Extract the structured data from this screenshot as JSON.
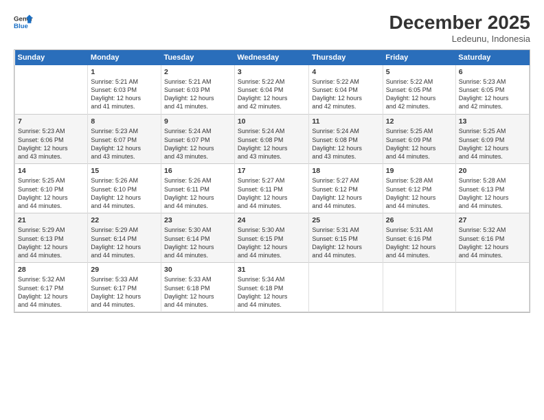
{
  "logo": {
    "line1": "General",
    "line2": "Blue"
  },
  "title": "December 2025",
  "location": "Ledeunu, Indonesia",
  "days_of_week": [
    "Sunday",
    "Monday",
    "Tuesday",
    "Wednesday",
    "Thursday",
    "Friday",
    "Saturday"
  ],
  "weeks": [
    [
      {
        "day": "",
        "info": ""
      },
      {
        "day": "1",
        "info": "Sunrise: 5:21 AM\nSunset: 6:03 PM\nDaylight: 12 hours\nand 41 minutes."
      },
      {
        "day": "2",
        "info": "Sunrise: 5:21 AM\nSunset: 6:03 PM\nDaylight: 12 hours\nand 41 minutes."
      },
      {
        "day": "3",
        "info": "Sunrise: 5:22 AM\nSunset: 6:04 PM\nDaylight: 12 hours\nand 42 minutes."
      },
      {
        "day": "4",
        "info": "Sunrise: 5:22 AM\nSunset: 6:04 PM\nDaylight: 12 hours\nand 42 minutes."
      },
      {
        "day": "5",
        "info": "Sunrise: 5:22 AM\nSunset: 6:05 PM\nDaylight: 12 hours\nand 42 minutes."
      },
      {
        "day": "6",
        "info": "Sunrise: 5:23 AM\nSunset: 6:05 PM\nDaylight: 12 hours\nand 42 minutes."
      }
    ],
    [
      {
        "day": "7",
        "info": "Sunrise: 5:23 AM\nSunset: 6:06 PM\nDaylight: 12 hours\nand 43 minutes."
      },
      {
        "day": "8",
        "info": "Sunrise: 5:23 AM\nSunset: 6:07 PM\nDaylight: 12 hours\nand 43 minutes."
      },
      {
        "day": "9",
        "info": "Sunrise: 5:24 AM\nSunset: 6:07 PM\nDaylight: 12 hours\nand 43 minutes."
      },
      {
        "day": "10",
        "info": "Sunrise: 5:24 AM\nSunset: 6:08 PM\nDaylight: 12 hours\nand 43 minutes."
      },
      {
        "day": "11",
        "info": "Sunrise: 5:24 AM\nSunset: 6:08 PM\nDaylight: 12 hours\nand 43 minutes."
      },
      {
        "day": "12",
        "info": "Sunrise: 5:25 AM\nSunset: 6:09 PM\nDaylight: 12 hours\nand 44 minutes."
      },
      {
        "day": "13",
        "info": "Sunrise: 5:25 AM\nSunset: 6:09 PM\nDaylight: 12 hours\nand 44 minutes."
      }
    ],
    [
      {
        "day": "14",
        "info": "Sunrise: 5:25 AM\nSunset: 6:10 PM\nDaylight: 12 hours\nand 44 minutes."
      },
      {
        "day": "15",
        "info": "Sunrise: 5:26 AM\nSunset: 6:10 PM\nDaylight: 12 hours\nand 44 minutes."
      },
      {
        "day": "16",
        "info": "Sunrise: 5:26 AM\nSunset: 6:11 PM\nDaylight: 12 hours\nand 44 minutes."
      },
      {
        "day": "17",
        "info": "Sunrise: 5:27 AM\nSunset: 6:11 PM\nDaylight: 12 hours\nand 44 minutes."
      },
      {
        "day": "18",
        "info": "Sunrise: 5:27 AM\nSunset: 6:12 PM\nDaylight: 12 hours\nand 44 minutes."
      },
      {
        "day": "19",
        "info": "Sunrise: 5:28 AM\nSunset: 6:12 PM\nDaylight: 12 hours\nand 44 minutes."
      },
      {
        "day": "20",
        "info": "Sunrise: 5:28 AM\nSunset: 6:13 PM\nDaylight: 12 hours\nand 44 minutes."
      }
    ],
    [
      {
        "day": "21",
        "info": "Sunrise: 5:29 AM\nSunset: 6:13 PM\nDaylight: 12 hours\nand 44 minutes."
      },
      {
        "day": "22",
        "info": "Sunrise: 5:29 AM\nSunset: 6:14 PM\nDaylight: 12 hours\nand 44 minutes."
      },
      {
        "day": "23",
        "info": "Sunrise: 5:30 AM\nSunset: 6:14 PM\nDaylight: 12 hours\nand 44 minutes."
      },
      {
        "day": "24",
        "info": "Sunrise: 5:30 AM\nSunset: 6:15 PM\nDaylight: 12 hours\nand 44 minutes."
      },
      {
        "day": "25",
        "info": "Sunrise: 5:31 AM\nSunset: 6:15 PM\nDaylight: 12 hours\nand 44 minutes."
      },
      {
        "day": "26",
        "info": "Sunrise: 5:31 AM\nSunset: 6:16 PM\nDaylight: 12 hours\nand 44 minutes."
      },
      {
        "day": "27",
        "info": "Sunrise: 5:32 AM\nSunset: 6:16 PM\nDaylight: 12 hours\nand 44 minutes."
      }
    ],
    [
      {
        "day": "28",
        "info": "Sunrise: 5:32 AM\nSunset: 6:17 PM\nDaylight: 12 hours\nand 44 minutes."
      },
      {
        "day": "29",
        "info": "Sunrise: 5:33 AM\nSunset: 6:17 PM\nDaylight: 12 hours\nand 44 minutes."
      },
      {
        "day": "30",
        "info": "Sunrise: 5:33 AM\nSunset: 6:18 PM\nDaylight: 12 hours\nand 44 minutes."
      },
      {
        "day": "31",
        "info": "Sunrise: 5:34 AM\nSunset: 6:18 PM\nDaylight: 12 hours\nand 44 minutes."
      },
      {
        "day": "",
        "info": ""
      },
      {
        "day": "",
        "info": ""
      },
      {
        "day": "",
        "info": ""
      }
    ]
  ]
}
